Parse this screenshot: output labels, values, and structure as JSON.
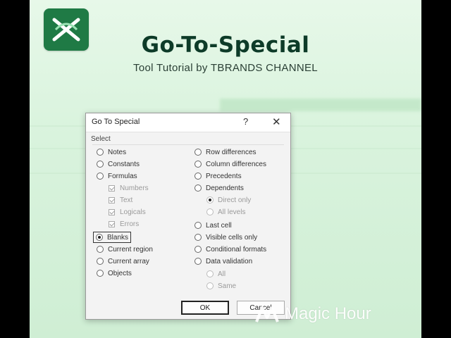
{
  "header": {
    "title": "Go-To-Special",
    "subtitle": "Tool Tutorial by TBRANDS CHANNEL"
  },
  "dialog": {
    "title": "Go To Special",
    "help_label": "?",
    "close_label": "✕",
    "group_label": "Select",
    "left_options": [
      {
        "label": "Notes"
      },
      {
        "label": "Constants"
      },
      {
        "label": "Formulas"
      },
      {
        "label": "Numbers"
      },
      {
        "label": "Text"
      },
      {
        "label": "Logicals"
      },
      {
        "label": "Errors"
      },
      {
        "label": "Blanks"
      },
      {
        "label": "Current region"
      },
      {
        "label": "Current array"
      },
      {
        "label": "Objects"
      }
    ],
    "right_options": [
      {
        "label": "Row differences"
      },
      {
        "label": "Column differences"
      },
      {
        "label": "Precedents"
      },
      {
        "label": "Dependents"
      },
      {
        "label": "Direct only"
      },
      {
        "label": "All levels"
      },
      {
        "label": "Last cell"
      },
      {
        "label": "Visible cells only"
      },
      {
        "label": "Conditional formats"
      },
      {
        "label": "Data validation"
      },
      {
        "label": "All"
      },
      {
        "label": "Same"
      }
    ],
    "selected": "Blanks",
    "ok_label": "OK",
    "cancel_label": "Cancel"
  },
  "watermark": {
    "text": "Magic Hour"
  },
  "colors": {
    "background": "#d9f3dd",
    "title": "#0d3b28",
    "logo": "#1f7a45"
  }
}
